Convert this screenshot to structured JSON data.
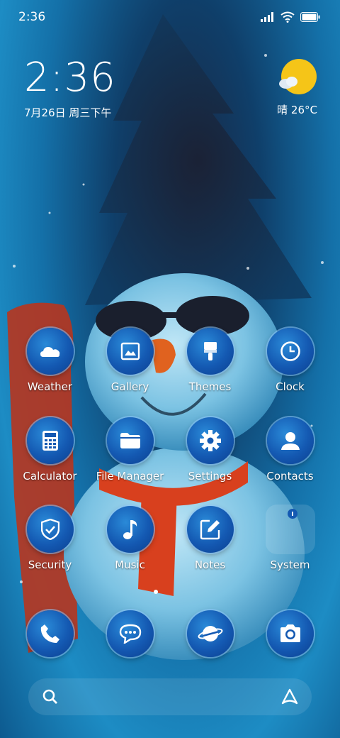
{
  "status_bar": {
    "time": "2:36",
    "icons": [
      "signal-icon",
      "wifi-icon",
      "battery-icon"
    ]
  },
  "clock_widget": {
    "time": "2:36",
    "date": "7月26日 周三下午"
  },
  "weather_widget": {
    "icon": "sun-cloud-icon",
    "text": "晴 26°C"
  },
  "apps": [
    {
      "label": "Weather",
      "icon": "weather-icon"
    },
    {
      "label": "Gallery",
      "icon": "gallery-icon"
    },
    {
      "label": "Themes",
      "icon": "brush-icon"
    },
    {
      "label": "Clock",
      "icon": "clock-icon"
    },
    {
      "label": "Calculator",
      "icon": "calculator-icon"
    },
    {
      "label": "File Manager",
      "icon": "folder-icon"
    },
    {
      "label": "Settings",
      "icon": "gear-icon"
    },
    {
      "label": "Contacts",
      "icon": "person-icon"
    },
    {
      "label": "Security",
      "icon": "shield-icon"
    },
    {
      "label": "Music",
      "icon": "music-note-icon"
    },
    {
      "label": "Notes",
      "icon": "edit-icon"
    },
    {
      "label": "System",
      "icon": "folder-icon"
    }
  ],
  "dock": [
    {
      "icon": "phone-icon"
    },
    {
      "icon": "message-icon"
    },
    {
      "icon": "browser-icon"
    },
    {
      "icon": "camera-icon"
    }
  ],
  "search_bar": {
    "left_icon": "search-icon",
    "right_icon": "assistant-icon"
  },
  "colors": {
    "icon_bg": "#1459b2",
    "icon_ring": "#8cc8ff",
    "sun": "#f5c518",
    "scarf": "#d8401e"
  }
}
